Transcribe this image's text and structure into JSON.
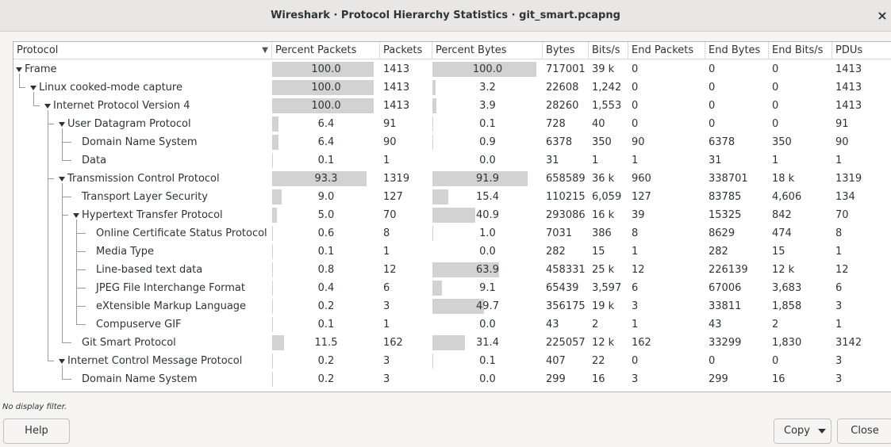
{
  "window": {
    "title": "Wireshark · Protocol Hierarchy Statistics · git_smart.pcapng",
    "close_glyph": "×"
  },
  "columns": [
    "Protocol",
    "Percent Packets",
    "Packets",
    "Percent Bytes",
    "Bytes",
    "Bits/s",
    "End Packets",
    "End Bytes",
    "End Bits/s",
    "PDUs"
  ],
  "rows": [
    {
      "protocol": "Frame",
      "depth": 0,
      "expanded": true,
      "pct_packets": "100.0",
      "pct_packets_val": 100.0,
      "packets": "1413",
      "pct_bytes": "100.0",
      "pct_bytes_val": 100.0,
      "bytes": "717001",
      "bits_s": "39 k",
      "end_packets": "0",
      "end_bytes": "0",
      "end_bits_s": "0",
      "pdus": "1413"
    },
    {
      "protocol": "Linux cooked-mode capture",
      "depth": 1,
      "expanded": true,
      "pct_packets": "100.0",
      "pct_packets_val": 100.0,
      "packets": "1413",
      "pct_bytes": "3.2",
      "pct_bytes_val": 3.2,
      "bytes": "22608",
      "bits_s": "1,242",
      "end_packets": "0",
      "end_bytes": "0",
      "end_bits_s": "0",
      "pdus": "1413"
    },
    {
      "protocol": "Internet Protocol Version 4",
      "depth": 2,
      "expanded": true,
      "pct_packets": "100.0",
      "pct_packets_val": 100.0,
      "packets": "1413",
      "pct_bytes": "3.9",
      "pct_bytes_val": 3.9,
      "bytes": "28260",
      "bits_s": "1,553",
      "end_packets": "0",
      "end_bytes": "0",
      "end_bits_s": "0",
      "pdus": "1413"
    },
    {
      "protocol": "User Datagram Protocol",
      "depth": 3,
      "expanded": true,
      "pct_packets": "6.4",
      "pct_packets_val": 6.4,
      "packets": "91",
      "pct_bytes": "0.1",
      "pct_bytes_val": 0.1,
      "bytes": "728",
      "bits_s": "40",
      "end_packets": "0",
      "end_bytes": "0",
      "end_bits_s": "0",
      "pdus": "91"
    },
    {
      "protocol": "Domain Name System",
      "depth": 4,
      "expanded": false,
      "pct_packets": "6.4",
      "pct_packets_val": 6.4,
      "packets": "90",
      "pct_bytes": "0.9",
      "pct_bytes_val": 0.9,
      "bytes": "6378",
      "bits_s": "350",
      "end_packets": "90",
      "end_bytes": "6378",
      "end_bits_s": "350",
      "pdus": "90"
    },
    {
      "protocol": "Data",
      "depth": 4,
      "expanded": false,
      "pct_packets": "0.1",
      "pct_packets_val": 0.1,
      "packets": "1",
      "pct_bytes": "0.0",
      "pct_bytes_val": 0.0,
      "bytes": "31",
      "bits_s": "1",
      "end_packets": "1",
      "end_bytes": "31",
      "end_bits_s": "1",
      "pdus": "1"
    },
    {
      "protocol": "Transmission Control Protocol",
      "depth": 3,
      "expanded": true,
      "pct_packets": "93.3",
      "pct_packets_val": 93.3,
      "packets": "1319",
      "pct_bytes": "91.9",
      "pct_bytes_val": 91.9,
      "bytes": "658589",
      "bits_s": "36 k",
      "end_packets": "960",
      "end_bytes": "338701",
      "end_bits_s": "18 k",
      "pdus": "1319"
    },
    {
      "protocol": "Transport Layer Security",
      "depth": 4,
      "expanded": false,
      "pct_packets": "9.0",
      "pct_packets_val": 9.0,
      "packets": "127",
      "pct_bytes": "15.4",
      "pct_bytes_val": 15.4,
      "bytes": "110215",
      "bits_s": "6,059",
      "end_packets": "127",
      "end_bytes": "83785",
      "end_bits_s": "4,606",
      "pdus": "134"
    },
    {
      "protocol": "Hypertext Transfer Protocol",
      "depth": 4,
      "expanded": true,
      "pct_packets": "5.0",
      "pct_packets_val": 5.0,
      "packets": "70",
      "pct_bytes": "40.9",
      "pct_bytes_val": 40.9,
      "bytes": "293086",
      "bits_s": "16 k",
      "end_packets": "39",
      "end_bytes": "15325",
      "end_bits_s": "842",
      "pdus": "70"
    },
    {
      "protocol": "Online Certificate Status Protocol",
      "depth": 5,
      "expanded": false,
      "pct_packets": "0.6",
      "pct_packets_val": 0.6,
      "packets": "8",
      "pct_bytes": "1.0",
      "pct_bytes_val": 1.0,
      "bytes": "7031",
      "bits_s": "386",
      "end_packets": "8",
      "end_bytes": "8629",
      "end_bits_s": "474",
      "pdus": "8"
    },
    {
      "protocol": "Media Type",
      "depth": 5,
      "expanded": false,
      "pct_packets": "0.1",
      "pct_packets_val": 0.1,
      "packets": "1",
      "pct_bytes": "0.0",
      "pct_bytes_val": 0.0,
      "bytes": "282",
      "bits_s": "15",
      "end_packets": "1",
      "end_bytes": "282",
      "end_bits_s": "15",
      "pdus": "1"
    },
    {
      "protocol": "Line-based text data",
      "depth": 5,
      "expanded": false,
      "pct_packets": "0.8",
      "pct_packets_val": 0.8,
      "packets": "12",
      "pct_bytes": "63.9",
      "pct_bytes_val": 63.9,
      "bytes": "458331",
      "bits_s": "25 k",
      "end_packets": "12",
      "end_bytes": "226139",
      "end_bits_s": "12 k",
      "pdus": "12"
    },
    {
      "protocol": "JPEG File Interchange Format",
      "depth": 5,
      "expanded": false,
      "pct_packets": "0.4",
      "pct_packets_val": 0.4,
      "packets": "6",
      "pct_bytes": "9.1",
      "pct_bytes_val": 9.1,
      "bytes": "65439",
      "bits_s": "3,597",
      "end_packets": "6",
      "end_bytes": "67006",
      "end_bits_s": "3,683",
      "pdus": "6"
    },
    {
      "protocol": "eXtensible Markup Language",
      "depth": 5,
      "expanded": false,
      "pct_packets": "0.2",
      "pct_packets_val": 0.2,
      "packets": "3",
      "pct_bytes": "49.7",
      "pct_bytes_val": 49.7,
      "bytes": "356175",
      "bits_s": "19 k",
      "end_packets": "3",
      "end_bytes": "33811",
      "end_bits_s": "1,858",
      "pdus": "3"
    },
    {
      "protocol": "Compuserve GIF",
      "depth": 5,
      "expanded": false,
      "pct_packets": "0.1",
      "pct_packets_val": 0.1,
      "packets": "1",
      "pct_bytes": "0.0",
      "pct_bytes_val": 0.0,
      "bytes": "43",
      "bits_s": "2",
      "end_packets": "1",
      "end_bytes": "43",
      "end_bits_s": "2",
      "pdus": "1"
    },
    {
      "protocol": "Git Smart Protocol",
      "depth": 4,
      "expanded": false,
      "pct_packets": "11.5",
      "pct_packets_val": 11.5,
      "packets": "162",
      "pct_bytes": "31.4",
      "pct_bytes_val": 31.4,
      "bytes": "225057",
      "bits_s": "12 k",
      "end_packets": "162",
      "end_bytes": "33299",
      "end_bits_s": "1,830",
      "pdus": "3142"
    },
    {
      "protocol": "Internet Control Message Protocol",
      "depth": 3,
      "expanded": true,
      "pct_packets": "0.2",
      "pct_packets_val": 0.2,
      "packets": "3",
      "pct_bytes": "0.1",
      "pct_bytes_val": 0.1,
      "bytes": "407",
      "bits_s": "22",
      "end_packets": "0",
      "end_bytes": "0",
      "end_bits_s": "0",
      "pdus": "3"
    },
    {
      "protocol": "Domain Name System",
      "depth": 4,
      "expanded": false,
      "pct_packets": "0.2",
      "pct_packets_val": 0.2,
      "packets": "3",
      "pct_bytes": "0.0",
      "pct_bytes_val": 0.0,
      "bytes": "299",
      "bits_s": "16",
      "end_packets": "3",
      "end_bytes": "299",
      "end_bits_s": "16",
      "pdus": "3"
    }
  ],
  "status": {
    "filter_text": "No display filter."
  },
  "buttons": {
    "help": "Help",
    "copy": "Copy",
    "close": "Close"
  },
  "colors": {
    "bar": "#d2d2d2",
    "tree_line": "#9a9a9a"
  }
}
